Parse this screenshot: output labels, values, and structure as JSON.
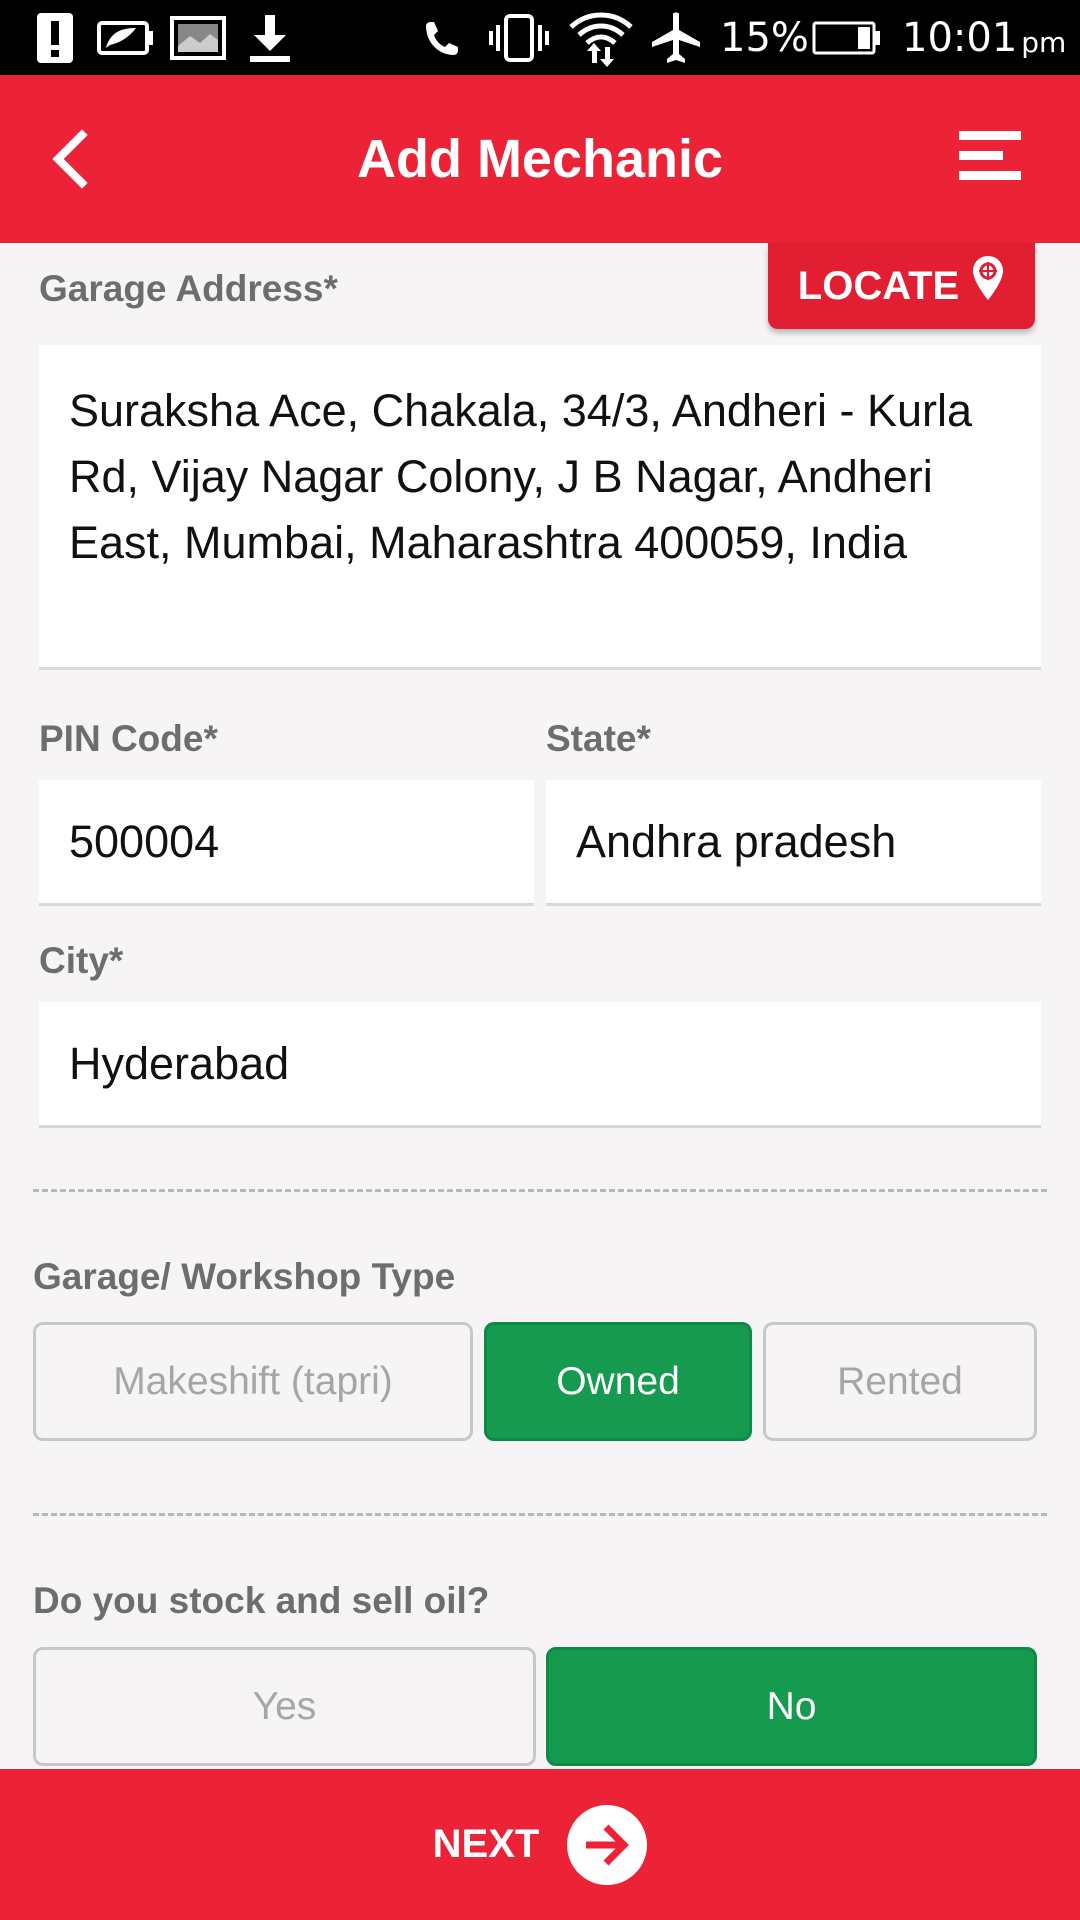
{
  "status_bar": {
    "battery_percent": "15%",
    "time": "10:01",
    "time_suffix": "pm",
    "icons": [
      "alert-icon",
      "battery-saver-icon",
      "gallery-icon",
      "download-icon",
      "phone-icon",
      "vibrate-icon",
      "wifi-icon",
      "airplane-icon",
      "battery-icon"
    ]
  },
  "header": {
    "title": "Add Mechanic",
    "back_icon": "chevron-left-icon",
    "menu_icon": "menu-icon"
  },
  "form": {
    "garage_address": {
      "label": "Garage Address*",
      "value": "Suraksha Ace, Chakala, 34/3, Andheri - Kurla Rd, Vijay Nagar Colony, J B Nagar, Andheri East, Mumbai, Maharashtra 400059, India",
      "locate_label": "LOCATE"
    },
    "pin_code": {
      "label": "PIN Code*",
      "value": "500004"
    },
    "state": {
      "label": "State*",
      "value": "Andhra pradesh"
    },
    "city": {
      "label": "City*",
      "value": "Hyderabad"
    },
    "garage_type": {
      "label": "Garage/ Workshop Type",
      "options": [
        "Makeshift (tapri)",
        "Owned",
        "Rented"
      ],
      "selected": "Owned"
    },
    "stock_oil": {
      "label": "Do you stock and sell oil?",
      "options": [
        "Yes",
        "No"
      ],
      "selected": "No"
    }
  },
  "footer": {
    "next_label": "NEXT"
  },
  "colors": {
    "primary": "#ec2237",
    "selected": "#159a4f"
  }
}
